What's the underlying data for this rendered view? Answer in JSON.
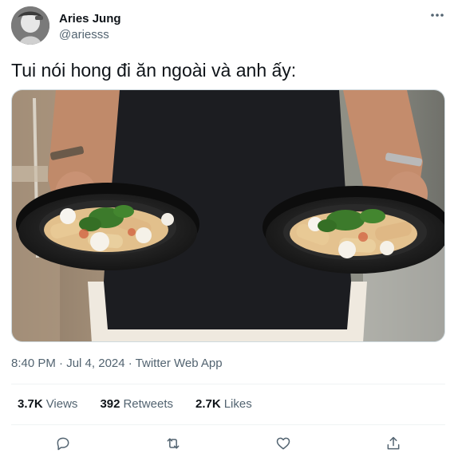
{
  "tweet": {
    "author": {
      "display_name": "Aries Jung",
      "handle": "@ariesss",
      "avatar_icon": "avatar-photo"
    },
    "text": "Tui nói hong đi ăn ngoài và anh ấy:",
    "media": {
      "type": "photo",
      "icon": "photo-man-holding-two-pasta-plates"
    },
    "meta": {
      "time": "8:40 PM",
      "separator1": " · ",
      "date": "Jul 4, 2024",
      "separator2": " · ",
      "source": "Twitter Web App"
    },
    "stats": {
      "views": {
        "value": "3.7K",
        "label": "Views"
      },
      "retweets": {
        "value": "392",
        "label": "Retweets"
      },
      "likes": {
        "value": "2.7K",
        "label": "Likes"
      }
    },
    "actions": [
      {
        "name": "reply",
        "icon": "reply-icon"
      },
      {
        "name": "retweet",
        "icon": "retweet-icon"
      },
      {
        "name": "like",
        "icon": "heart-icon"
      },
      {
        "name": "share",
        "icon": "share-icon"
      }
    ]
  },
  "colors": {
    "primary_text": "#0f1419",
    "secondary_text": "#536471",
    "divider": "#eff3f4",
    "icon": "#536471"
  }
}
